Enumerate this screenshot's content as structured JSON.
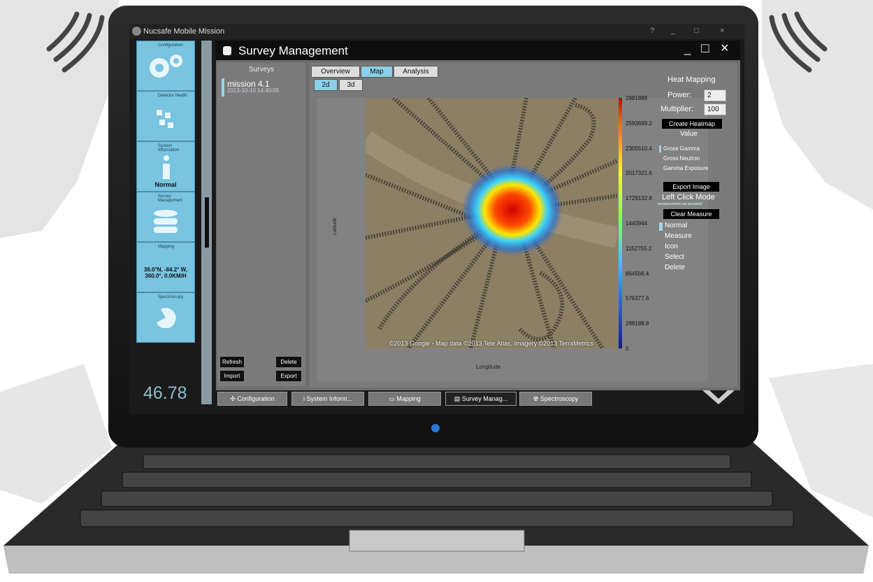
{
  "colors": {
    "accent": "#79c4e0",
    "heat_hot": "#cc0000",
    "heat_cold": "#3366ff"
  },
  "app": {
    "title": "Nucsafe Mobile Mission",
    "controls": [
      "?",
      "_",
      "□",
      "×"
    ]
  },
  "sidebar": {
    "tiles": [
      {
        "label": "Configuration",
        "icon": "gear-icon"
      },
      {
        "label": "Detector Health",
        "icon": "grid-icon"
      },
      {
        "label": "System Information",
        "icon": "info-icon",
        "status": "Normal"
      },
      {
        "label": "Survey Management",
        "icon": "database-icon"
      },
      {
        "label": "Mapping",
        "icon": "map-icon",
        "value": "36.0°N, -84.2° W, 360.0°, 0.0KM/H"
      },
      {
        "label": "Spectroscopy",
        "icon": "radiation-icon"
      }
    ],
    "speed": "46.78"
  },
  "window": {
    "title": "Survey Management",
    "controls": [
      "_",
      "□",
      "×"
    ]
  },
  "surveys": {
    "header": "Surveys",
    "items": [
      {
        "name": "mission 4.1",
        "date": "2013-10-10 14:40:05"
      }
    ],
    "buttons": {
      "refresh": "Refresh",
      "delete": "Delete",
      "import": "Import",
      "export": "Export"
    }
  },
  "tabs": [
    "Overview",
    "Map",
    "Analysis"
  ],
  "view_tabs": [
    "2d",
    "3d"
  ],
  "map": {
    "credit": "©2013 Google - Map data ©2013 Tele Atlas, Imagery ©2013 TerraMetrics",
    "ylabel": "Latitude",
    "xlabel": "Longitude",
    "colorbar_ticks": [
      "2881888",
      "2593699.2",
      "2305510.4",
      "2017321.6",
      "1729132.8",
      "1440944",
      "1152755.2",
      "864566.4",
      "576377.6",
      "288188.8",
      "0"
    ]
  },
  "heat_mapping": {
    "title": "Heat Mapping",
    "power_label": "Power:",
    "power_value": "2",
    "multiplier_label": "Multiplier:",
    "multiplier_value": "100",
    "create_button": "Create Heatmap",
    "value_label": "Value",
    "value_options": [
      "Gross Gamma",
      "Gross Neutron",
      "Gamma Exposure"
    ],
    "export_button": "Export Image",
    "left_click_label": "Left Click Mode",
    "left_click_note": "measurements not persisted",
    "clear_button": "Clear Measure",
    "modes": [
      "Normal",
      "Measure",
      "Icon",
      "Select",
      "Delete"
    ]
  },
  "taskbar": [
    {
      "label": "Configuration",
      "icon": "gear-icon"
    },
    {
      "label": "System Inform...",
      "icon": "info-icon"
    },
    {
      "label": "Mapping",
      "icon": "map-icon"
    },
    {
      "label": "Survey Manag...",
      "icon": "database-icon"
    },
    {
      "label": "Spectroscopy",
      "icon": "radiation-icon"
    }
  ]
}
